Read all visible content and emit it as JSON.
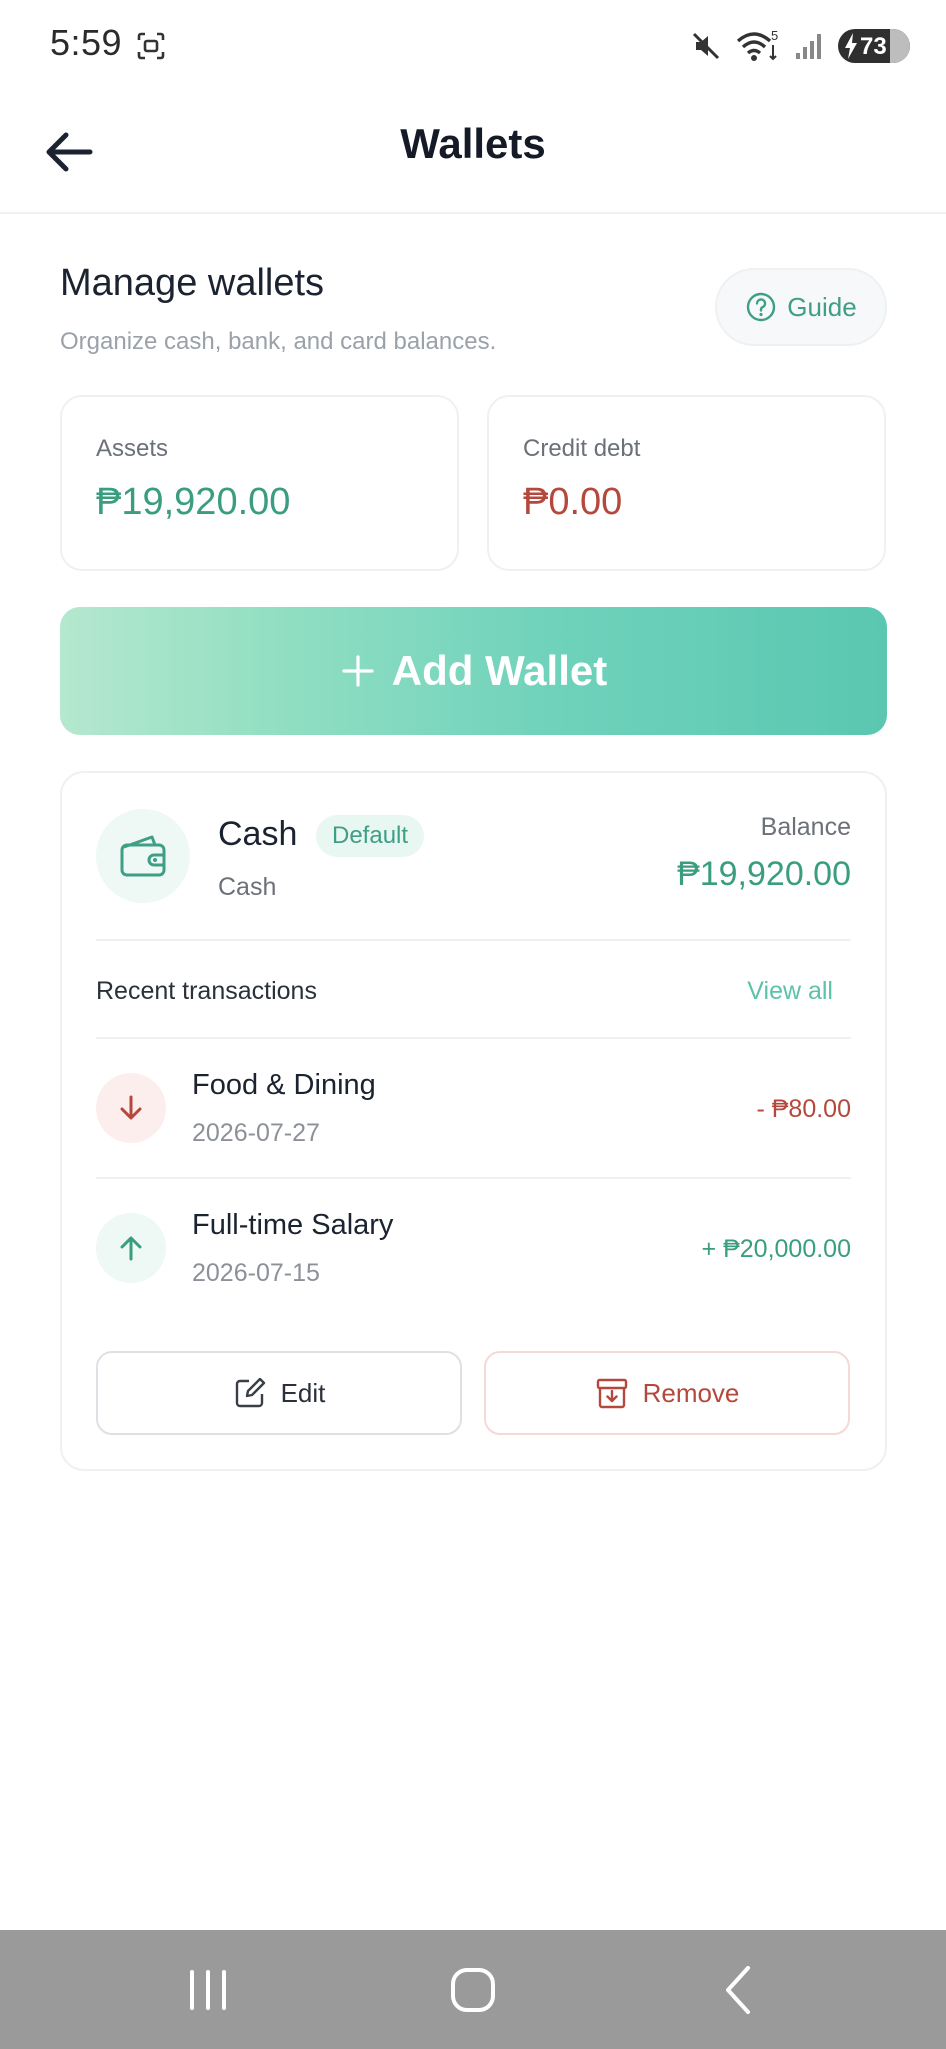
{
  "status_bar": {
    "time": "5:59",
    "battery_level": "73",
    "wifi_badge": "5",
    "icons": [
      "screenshot-icon",
      "mute-icon",
      "wifi-icon",
      "signal-icon",
      "battery-charging-icon"
    ]
  },
  "header": {
    "title": "Wallets",
    "back_icon": "arrow-left-icon"
  },
  "manage": {
    "title": "Manage wallets",
    "subtitle": "Organize cash, bank, and card balances.",
    "guide_label": "Guide",
    "guide_icon": "help-circle-icon"
  },
  "summary": {
    "assets_label": "Assets",
    "assets_value": "₱19,920.00",
    "debt_label": "Credit debt",
    "debt_value": "₱0.00"
  },
  "add_wallet": {
    "label": "Add Wallet",
    "icon": "plus-icon"
  },
  "wallet": {
    "name": "Cash",
    "badge": "Default",
    "type": "Cash",
    "balance_label": "Balance",
    "balance_value": "₱19,920.00",
    "icon": "wallet-icon",
    "recent_label": "Recent transactions",
    "view_all_label": "View all",
    "transactions": [
      {
        "name": "Food & Dining",
        "date": "2026-07-27",
        "amount": "- ₱80.00",
        "kind": "expense",
        "icon": "arrow-down-icon"
      },
      {
        "name": "Full-time Salary",
        "date": "2026-07-15",
        "amount": "+ ₱20,000.00",
        "kind": "income",
        "icon": "arrow-up-icon"
      }
    ],
    "edit_label": "Edit",
    "remove_label": "Remove"
  },
  "colors": {
    "accent": "#3f9e86",
    "income": "#3a9d80",
    "expense": "#b5483c",
    "gradient_start": "#b5e8cf",
    "gradient_end": "#5bc7b1",
    "nav_bar": "#9a9a9a"
  }
}
